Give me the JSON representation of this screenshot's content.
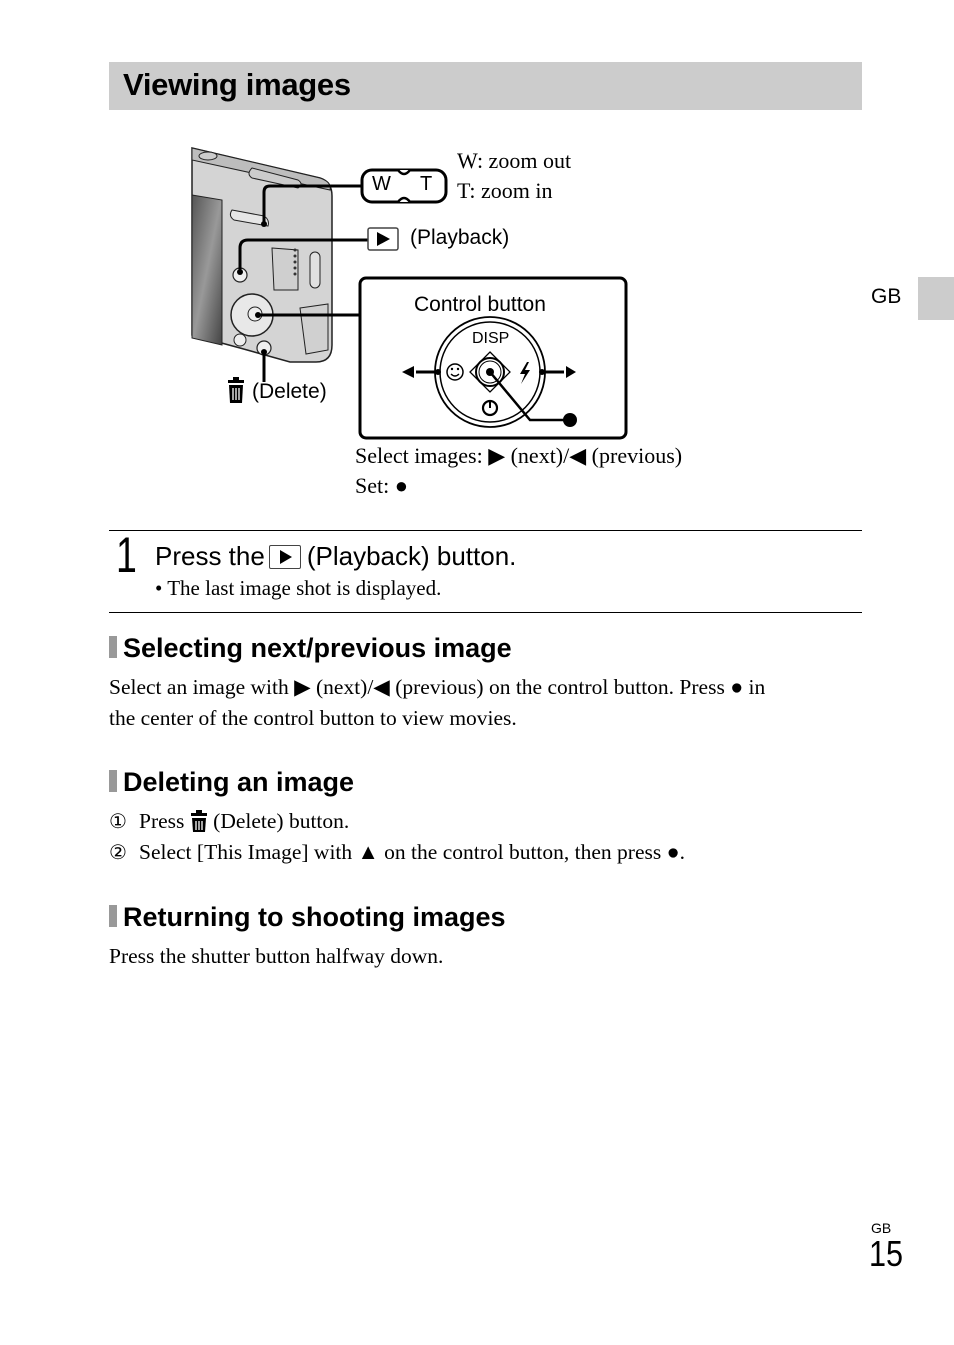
{
  "page": {
    "title": "Viewing images",
    "side_tab_label": "GB",
    "footer_lang": "GB",
    "page_number": "15"
  },
  "diagram": {
    "zoom_lever": {
      "w_label": "W",
      "t_label": "T",
      "line1": "W: zoom out",
      "line2": "T: zoom in"
    },
    "playback_label": "(Playback)",
    "delete_label": "(Delete)",
    "control_button": {
      "title": "Control button",
      "disp_label": "DISP"
    },
    "caption_line1_prefix": "Select images: ",
    "caption_next": "▶ (next)/",
    "caption_prev": "◀ (previous)",
    "caption_line2": "Set: ●"
  },
  "step": {
    "number": "1",
    "title_prefix": "Press the",
    "title_suffix": "(Playback) button.",
    "bullet": "• The last image shot is displayed."
  },
  "sections": [
    {
      "heading": "Selecting next/previous image",
      "lines": [
        "Select an image with ▶ (next)/◀ (previous) on the control button. Press ● in",
        "the center of the control button to view movies."
      ]
    },
    {
      "heading": "Deleting an image",
      "items": [
        {
          "marker": "①",
          "prefix": "Press ",
          "suffix": " (Delete) button."
        },
        {
          "marker": "②",
          "text": "Select [This Image] with ▲ on the control button, then press ●."
        }
      ]
    },
    {
      "heading": "Returning to shooting images",
      "lines": [
        "Press the shutter button halfway down."
      ]
    }
  ]
}
